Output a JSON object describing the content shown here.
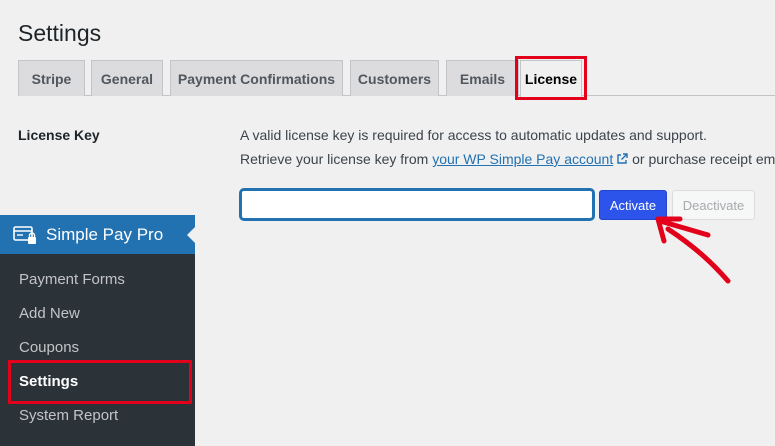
{
  "page": {
    "title": "Settings"
  },
  "tabs": [
    {
      "label": "Stripe"
    },
    {
      "label": "General"
    },
    {
      "label": "Payment Confirmations"
    },
    {
      "label": "Customers"
    },
    {
      "label": "Emails"
    },
    {
      "label": "License",
      "active": true
    }
  ],
  "license": {
    "field_label": "License Key",
    "description_line1": "A valid license key is required for access to automatic updates and support.",
    "description_line2_prefix": "Retrieve your license key from ",
    "account_link_text": "your WP Simple Pay account",
    "description_line2_suffix": " or purchase receipt em",
    "input_value": "",
    "activate_label": "Activate",
    "deactivate_label": "Deactivate"
  },
  "sidebar": {
    "title": "Simple Pay Pro",
    "items": [
      {
        "label": "Payment Forms"
      },
      {
        "label": "Add New"
      },
      {
        "label": "Coupons"
      },
      {
        "label": "Settings",
        "current": true
      },
      {
        "label": "System Report"
      }
    ]
  },
  "colors": {
    "highlight": "#e2001a",
    "accent": "#2c54ea",
    "sidebar_active": "#2271b1"
  },
  "icons": {
    "external_link": "external-link-icon",
    "plugin": "simple-pay-card-lock-icon"
  }
}
